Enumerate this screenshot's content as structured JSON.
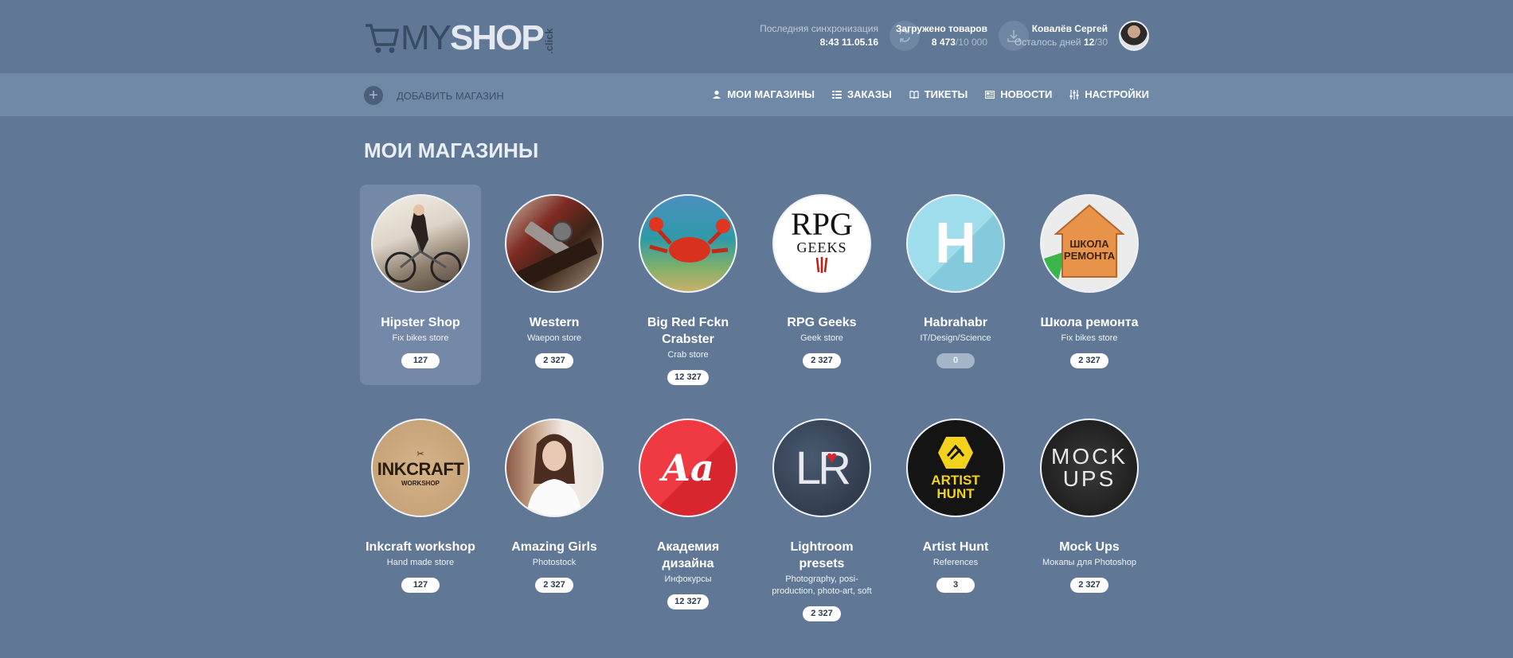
{
  "header": {
    "logo": {
      "my": "MY",
      "shop": "SHOP",
      "click": ".click"
    },
    "sync": {
      "label": "Последняя синхронизация",
      "value": "8:43  11.05.16"
    },
    "loaded": {
      "label": "Загружено товаров",
      "value": "8 473",
      "total": "/10 000"
    },
    "user": {
      "name": "Ковалёв Сергей",
      "days_label": "Осталось дней ",
      "days": "12",
      "days_total": "/30"
    }
  },
  "navbar": {
    "add_label": "ДОБАВИТЬ МАГАЗИН",
    "items": [
      {
        "label": "МОИ МАГАЗИНЫ",
        "icon": "user-icon"
      },
      {
        "label": "ЗАКАЗЫ",
        "icon": "list-icon"
      },
      {
        "label": "ТИКЕТЫ",
        "icon": "book-icon"
      },
      {
        "label": "НОВОСТИ",
        "icon": "newspaper-icon"
      },
      {
        "label": "НАСТРОЙКИ",
        "icon": "sliders-icon"
      }
    ]
  },
  "page_title": "МОИ МАГАЗИНЫ",
  "shops": [
    {
      "name": "Hipster Shop",
      "desc": "Fix bikes store",
      "count": "127",
      "active": true
    },
    {
      "name": "Western",
      "desc": "Waepon store",
      "count": "2 327"
    },
    {
      "name": "Big Red Fckn Crabster",
      "desc": "Crab store",
      "count": "12 327"
    },
    {
      "name": "RPG Geeks",
      "desc": "Geek store",
      "count": "2 327"
    },
    {
      "name": "Habrahabr",
      "desc": "IT/Design/Science",
      "count": "0"
    },
    {
      "name": "Школа ремонта",
      "desc": "Fix bikes store",
      "count": "2 327"
    },
    {
      "name": "Inkcraft workshop",
      "desc": "Hand made store",
      "count": "127"
    },
    {
      "name": "Amazing Girls",
      "desc": "Photostock",
      "count": "2 327"
    },
    {
      "name": "Академия дизайна",
      "desc": "Инфокурсы",
      "count": "12 327"
    },
    {
      "name": "Lightroom presets",
      "desc": "Photography, posi-production, photo-art, soft",
      "count": "2 327"
    },
    {
      "name": "Artist Hunt",
      "desc": "References",
      "count": "3"
    },
    {
      "name": "Mock Ups",
      "desc": "Мокапы для Photoshop",
      "count": "2 327"
    }
  ],
  "logos": {
    "rpg": "RPG",
    "geeks": "GEEKS",
    "habr": "H",
    "shkola1": "ШКОЛА",
    "shkola2": "РЕМОНТА",
    "inkcraft": "INKCRAFT",
    "workshop": "WORKSHOP",
    "aa": "Aa",
    "lr": "LR",
    "artist": "ARTIST",
    "hunt": "HUNT",
    "mock": "MOCK",
    "ups": "UPS"
  },
  "colors": {
    "background": "#607896",
    "navbar": "#7089a7",
    "active_card": "#7389a7"
  }
}
